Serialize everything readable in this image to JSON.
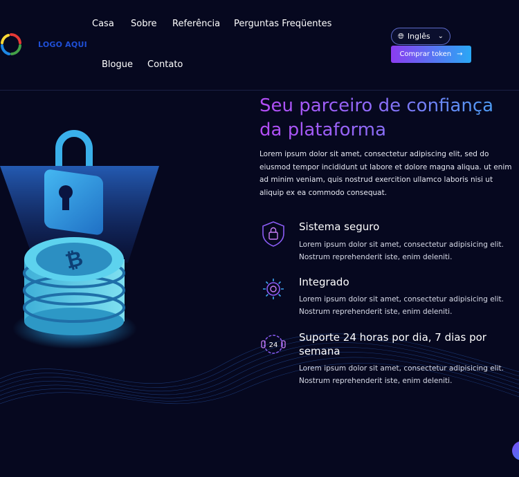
{
  "header": {
    "logo_text": "LOGO AQUI",
    "nav": [
      "Casa",
      "Sobre",
      "Referência",
      "Perguntas Freqüentes",
      "Blogue",
      "Contato"
    ],
    "language": "Inglês",
    "buy_label": "Comprar token"
  },
  "hero": {
    "title": "Seu parceiro de confiança da plataforma",
    "intro": "Lorem ipsum dolor sit amet, consectetur adipiscing elit, sed do eiusmod tempor incididunt ut labore et dolore magna aliqua. ut enim ad minim veniam, quis nostrud exercition ullamco laboris nisi ut aliquip ex ea commodo consequat."
  },
  "features": [
    {
      "icon": "shield-lock-icon",
      "title": "Sistema seguro",
      "text": "Lorem ipsum dolor sit amet, consectetur adipisicing elit. Nostrum reprehenderit iste, enim deleniti."
    },
    {
      "icon": "gear-integration-icon",
      "title": "Integrado",
      "text": "Lorem ipsum dolor sit amet, consectetur adipisicing elit. Nostrum reprehenderit iste, enim deleniti."
    },
    {
      "icon": "support-24-icon",
      "title": "Suporte 24 horas por dia, 7 dias por semana",
      "text": "Lorem ipsum dolor sit amet, consectetur adipisicing elit. Nostrum reprehenderit iste, enim deleniti."
    }
  ],
  "colors": {
    "background": "#06081f",
    "accent_purple": "#8b3cf0",
    "accent_blue": "#2aa8f5",
    "logo_blue": "#1f4fd6"
  }
}
